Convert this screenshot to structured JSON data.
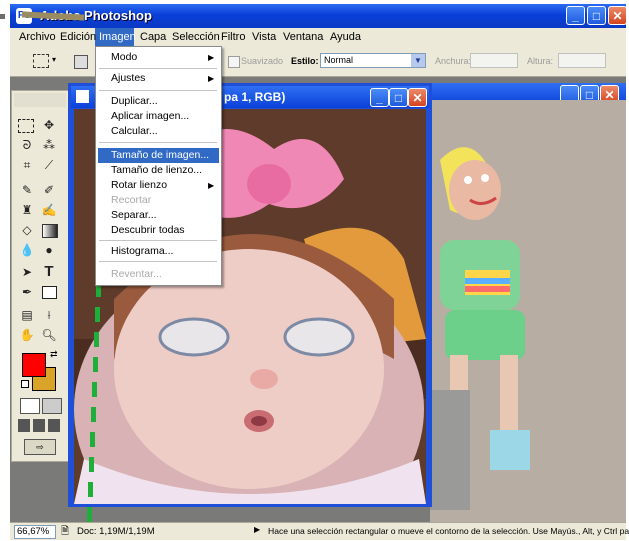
{
  "app": {
    "title": "Adobe Photoshop"
  },
  "window_controls": {
    "minimize": "_",
    "maximize": "□",
    "close": "✕"
  },
  "menubar": {
    "items": [
      "Archivo",
      "Edición",
      "Imagen",
      "Capa",
      "Selección",
      "Filtro",
      "Vista",
      "Ventana",
      "Ayuda"
    ]
  },
  "options": {
    "suavizado": "Suavizado",
    "estilo_label": "Estilo:",
    "estilo_value": "Normal",
    "anchura_label": "Anchura:",
    "altura_label": "Altura:"
  },
  "document": {
    "title_fragment": "pa 1, RGB)"
  },
  "dropdown": {
    "items": [
      {
        "label": "Modo",
        "submenu": true,
        "disabled": false
      },
      {
        "label": "Ajustes",
        "submenu": true,
        "disabled": false
      },
      {
        "label": "Duplicar...",
        "submenu": false,
        "disabled": false
      },
      {
        "label": "Aplicar imagen...",
        "submenu": false,
        "disabled": false
      },
      {
        "label": "Calcular...",
        "submenu": false,
        "disabled": false
      },
      {
        "label": "Tamaño de imagen...",
        "submenu": false,
        "disabled": false,
        "highlighted": true
      },
      {
        "label": "Tamaño de lienzo...",
        "submenu": false,
        "disabled": false
      },
      {
        "label": "Rotar lienzo",
        "submenu": true,
        "disabled": false
      },
      {
        "label": "Recortar",
        "submenu": false,
        "disabled": true
      },
      {
        "label": "Separar...",
        "submenu": false,
        "disabled": false
      },
      {
        "label": "Descubrir todas",
        "submenu": false,
        "disabled": false
      },
      {
        "label": "Histograma...",
        "submenu": false,
        "disabled": false
      },
      {
        "label": "Reventar...",
        "submenu": false,
        "disabled": true
      }
    ]
  },
  "status": {
    "zoom": "66,67%",
    "doc": "Doc: 1,19M/1,19M",
    "hint": "Hace una selección rectangular o mueve el contorno de la selección. Use Mayús., Alt, y Ctrl para"
  },
  "colors": {
    "foreground": "#ff0000",
    "background": "#d9a428",
    "accent": "#316ac5",
    "annotation": "#1fae3a"
  },
  "icons": [
    "photoshop-app-icon",
    "marquee-icon",
    "move-icon",
    "lasso-icon",
    "magic-wand-icon",
    "crop-icon",
    "slice-icon",
    "brush-icon",
    "stamp-icon",
    "eraser-icon",
    "gradient-icon",
    "dodge-icon",
    "path-select-icon",
    "type-icon",
    "pen-icon",
    "shape-icon",
    "notes-icon",
    "eyedropper-icon",
    "hand-icon",
    "zoom-icon",
    "swap-colors-icon",
    "quick-mask-icon",
    "screen-mode-icon",
    "jump-to-imageready-icon"
  ]
}
